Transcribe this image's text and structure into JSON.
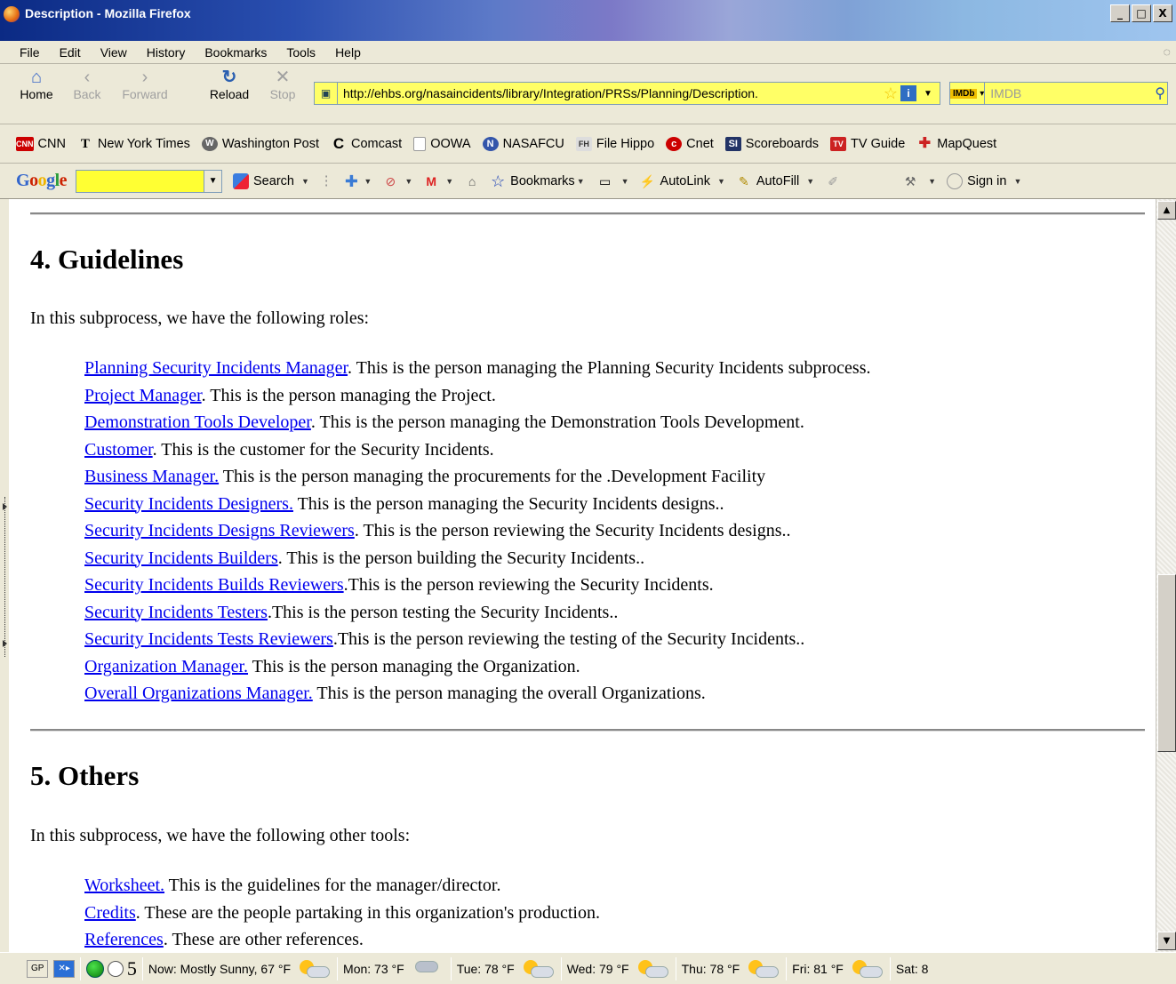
{
  "window": {
    "title": "Description - Mozilla Firefox",
    "buttons": [
      "_",
      "□",
      "X"
    ]
  },
  "menu": [
    "File",
    "Edit",
    "View",
    "History",
    "Bookmarks",
    "Tools",
    "Help"
  ],
  "nav": {
    "home": "Home",
    "back": "Back",
    "forward": "Forward",
    "reload": "Reload",
    "stop": "Stop",
    "url": "http://ehbs.org/nasaincidents/library/Integration/PRSs/Planning/Description.",
    "search_placeholder": "IMDB",
    "search_engine_badge": "IMDb"
  },
  "bookmarks": [
    {
      "icon_text": "CNN",
      "label": "CNN",
      "color": "#cc0000"
    },
    {
      "icon_text": "T",
      "label": "New York Times",
      "color": "#000000"
    },
    {
      "icon_text": "W",
      "label": "Washington Post",
      "color": "#333333"
    },
    {
      "icon_text": "C",
      "label": "Comcast",
      "color": "#000000"
    },
    {
      "icon_text": "",
      "label": "OOWA",
      "color": "#ffffff"
    },
    {
      "icon_text": "N",
      "label": "NASAFCU",
      "color": "#3355aa"
    },
    {
      "icon_text": "FH",
      "label": "File Hippo",
      "color": "#444444"
    },
    {
      "icon_text": "c",
      "label": "Cnet",
      "color": "#cc0000"
    },
    {
      "icon_text": "SI",
      "label": "Scoreboards",
      "color": "#223366"
    },
    {
      "icon_text": "TV",
      "label": "TV Guide",
      "color": "#cc2222"
    },
    {
      "icon_text": "✚",
      "label": "MapQuest",
      "color": "#cc2222"
    }
  ],
  "google_toolbar": {
    "logo": [
      "G",
      "o",
      "o",
      "g",
      "l",
      "e"
    ],
    "search": "Search",
    "bookmarks": "Bookmarks",
    "autolink": "AutoLink",
    "autofill": "AutoFill",
    "signin": "Sign in"
  },
  "page": {
    "section4": {
      "heading": "4. Guidelines",
      "intro": "In this subprocess, we have the following roles:",
      "items": [
        {
          "link": "Planning Security Incidents Manager",
          "text": ". This is the person managing the Planning Security Incidents subprocess."
        },
        {
          "link": "Project Manager",
          "text": ". This is the person managing the Project."
        },
        {
          "link": "Demonstration Tools Developer",
          "text": ". This is the person managing the Demonstration Tools Development."
        },
        {
          "link": "Customer",
          "text": ". This is the customer for the Security Incidents."
        },
        {
          "link": "Business Manager.",
          "text": " This is the person managing the procurements for the .Development Facility"
        },
        {
          "link": "Security Incidents Designers.",
          "text": " This is the person managing the Security Incidents designs.."
        },
        {
          "link": "Security Incidents Designs Reviewers",
          "text": ". This is the person reviewing the Security Incidents designs.."
        },
        {
          "link": "Security Incidents Builders",
          "text": ". This is the person building the Security Incidents.."
        },
        {
          "link": "Security Incidents Builds Reviewers",
          "text": ".This is the person reviewing the Security Incidents."
        },
        {
          "link": "Security Incidents Testers",
          "text": ".This is the person testing the Security Incidents.."
        },
        {
          "link": "Security Incidents Tests Reviewers",
          "text": ".This is the person reviewing the testing of the Security Incidents.."
        },
        {
          "link": "Organization Manager.",
          "text": " This is the person managing the Organization."
        },
        {
          "link": "Overall Organizations Manager.",
          "text": " This is the person managing the overall Organizations."
        }
      ]
    },
    "section5": {
      "heading": "5. Others",
      "intro": "In this subprocess, we have the following other tools:",
      "items": [
        {
          "link": "Worksheet.",
          "text": " This is the guidelines for the manager/director."
        },
        {
          "link": "Credits",
          "text": ". These are the people partaking in this organization's production."
        },
        {
          "link": "References",
          "text": ". These are other references."
        }
      ]
    }
  },
  "status": {
    "gp": "GP",
    "five": "5",
    "weather": [
      {
        "label": "Now: Mostly Sunny, 67 °F",
        "icon": "partly-sunny-icon"
      },
      {
        "label": "Mon: 73 °F",
        "icon": "rain-cloud-icon"
      },
      {
        "label": "Tue: 78 °F",
        "icon": "partly-sunny-icon"
      },
      {
        "label": "Wed: 79 °F",
        "icon": "partly-sunny-icon"
      },
      {
        "label": "Thu: 78 °F",
        "icon": "partly-sunny-icon"
      },
      {
        "label": "Fri: 81 °F",
        "icon": "partly-sunny-icon"
      },
      {
        "label": "Sat: 8",
        "icon": "partly-sunny-icon"
      }
    ]
  }
}
